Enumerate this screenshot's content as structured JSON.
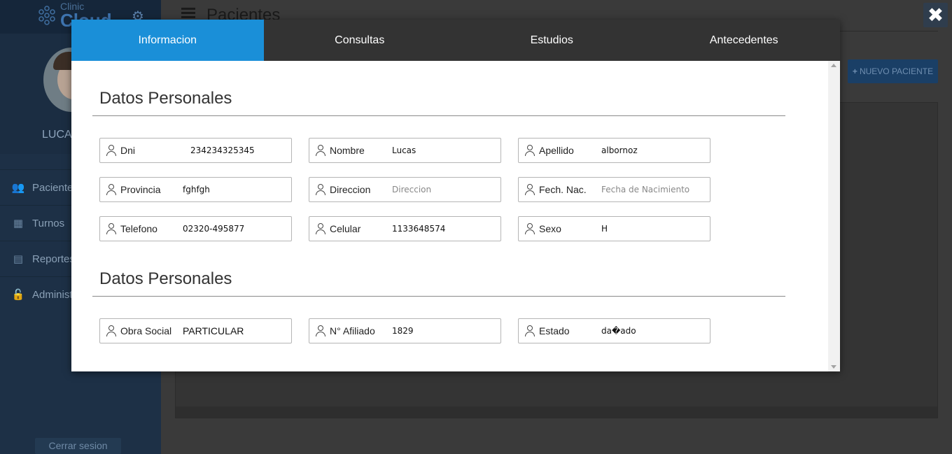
{
  "app": {
    "logo_top": "Clinic",
    "logo_bottom": "Cloud",
    "user_name": "LUCAS",
    "sidebar_items": [
      {
        "label": "Pacientes",
        "icon": "users-icon"
      },
      {
        "label": "Turnos",
        "icon": "calendar-icon"
      },
      {
        "label": "Reportes",
        "icon": "clipboard-icon"
      },
      {
        "label": "Administ",
        "icon": "lock-icon"
      }
    ],
    "logout_label": "Cerrar sesion",
    "page_title": "Pacientes",
    "new_patient_label": "NUEVO PACIENTE",
    "close_symbol": "✖"
  },
  "modal": {
    "tabs": [
      {
        "label": "Informacion",
        "active": true
      },
      {
        "label": "Consultas",
        "active": false
      },
      {
        "label": "Estudios",
        "active": false
      },
      {
        "label": "Antecedentes",
        "active": false
      }
    ],
    "section1_title": "Datos Personales",
    "section2_title": "Datos Personales",
    "fields": {
      "dni": {
        "label": "Dni",
        "value": "234234325345",
        "placeholder": ""
      },
      "nombre": {
        "label": "Nombre",
        "value": "Lucas",
        "placeholder": ""
      },
      "apellido": {
        "label": "Apellido",
        "value": "albornoz",
        "placeholder": ""
      },
      "provincia": {
        "label": "Provincia",
        "value": "fghfgh",
        "placeholder": ""
      },
      "direccion": {
        "label": "Direccion",
        "value": "",
        "placeholder": "Direccion"
      },
      "fech_nac": {
        "label": "Fech. Nac.",
        "value": "",
        "placeholder": "Fecha de Nacimiento"
      },
      "telefono": {
        "label": "Telefono",
        "value": "02320-495877",
        "placeholder": ""
      },
      "celular": {
        "label": "Celular",
        "value": "1133648574",
        "placeholder": ""
      },
      "sexo": {
        "label": "Sexo",
        "value": "H",
        "placeholder": ""
      },
      "obra_social": {
        "label": "Obra Social",
        "value": "PARTICULAR",
        "placeholder": ""
      },
      "afiliado": {
        "label": "N° Afiliado",
        "value": "1829",
        "placeholder": ""
      },
      "estado": {
        "label": "Estado",
        "value": "da�ado",
        "placeholder": ""
      }
    }
  },
  "colors": {
    "active_tab": "#1a8fd8",
    "tab_bar": "#333333",
    "sidebar": "#1d3046"
  }
}
